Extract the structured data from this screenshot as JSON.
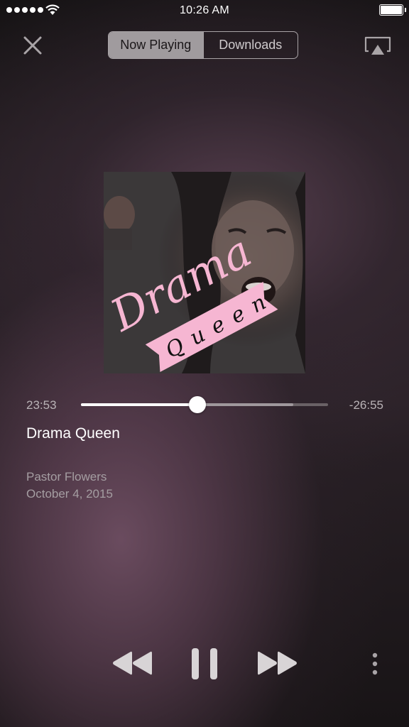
{
  "status_bar": {
    "time": "10:26 AM"
  },
  "tabs": [
    {
      "label": "Now Playing",
      "active": true
    },
    {
      "label": "Downloads",
      "active": false
    }
  ],
  "player": {
    "elapsed": "23:53",
    "remaining": "-26:55",
    "progress": 0.47,
    "buffered": 0.86,
    "title": "Drama Queen",
    "speaker": "Pastor Flowers",
    "date": "October 4, 2015"
  },
  "artwork": {
    "lettering_top": "Drama",
    "lettering_bottom": "Queen"
  },
  "colors": {
    "accent": "#ffffff",
    "banner_pink": "#f6b6d2",
    "secondary_text": "#a59ea2"
  },
  "icons": {
    "close": "close-icon",
    "airplay": "airplay-icon",
    "rewind": "rewind-icon",
    "pause": "pause-icon",
    "forward": "fast-forward-icon",
    "more": "more-vertical-icon"
  }
}
